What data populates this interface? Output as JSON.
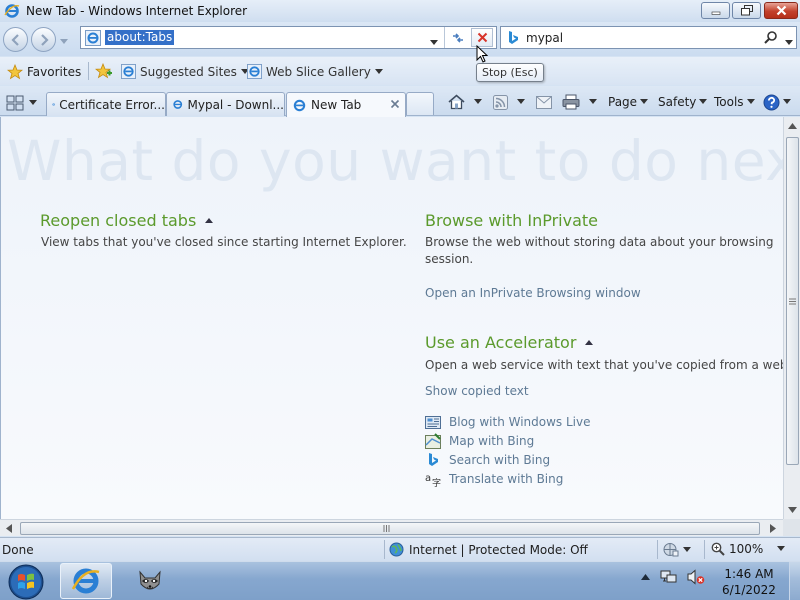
{
  "window": {
    "title": "New Tab - Windows Internet Explorer"
  },
  "nav": {
    "address": "about:Tabs",
    "search_text": "mypal",
    "tooltip": "Stop (Esc)"
  },
  "favorites_bar": {
    "favorites_label": "Favorites",
    "items": [
      {
        "label": "Suggested Sites"
      },
      {
        "label": "Web Slice Gallery"
      }
    ]
  },
  "tabs": [
    {
      "label": "Certificate Error...",
      "active": false
    },
    {
      "label": "Mypal - Downl...",
      "active": false
    },
    {
      "label": "New Tab",
      "active": true
    }
  ],
  "command_bar": {
    "page": "Page",
    "safety": "Safety",
    "tools": "Tools"
  },
  "content": {
    "headline": "What do you want to do next?",
    "reopen": {
      "title": "Reopen closed tabs",
      "description": "View tabs that you've closed since starting Internet Explorer."
    },
    "inprivate": {
      "title": "Browse with InPrivate",
      "description": "Browse the web without storing data about your browsing session.",
      "link": "Open an InPrivate Browsing window"
    },
    "accelerator": {
      "title": "Use an Accelerator",
      "description": "Open a web service with text that you've copied from a webp",
      "show_copied": "Show copied text",
      "items": [
        {
          "label": "Blog with Windows Live",
          "icon": "windows-live-icon"
        },
        {
          "label": "Map with Bing",
          "icon": "map-icon"
        },
        {
          "label": "Search with Bing",
          "icon": "bing-icon"
        },
        {
          "label": "Translate with Bing",
          "icon": "translate-icon"
        }
      ]
    }
  },
  "status": {
    "text": "Done",
    "zone": "Internet | Protected Mode: Off",
    "zoom": "100%"
  },
  "taskbar": {
    "time": "1:46 AM",
    "date": "6/1/2022"
  },
  "colors": {
    "accent_green": "#5b9a2c",
    "link_blue": "#5e7a95",
    "selection": "#3470c8"
  }
}
